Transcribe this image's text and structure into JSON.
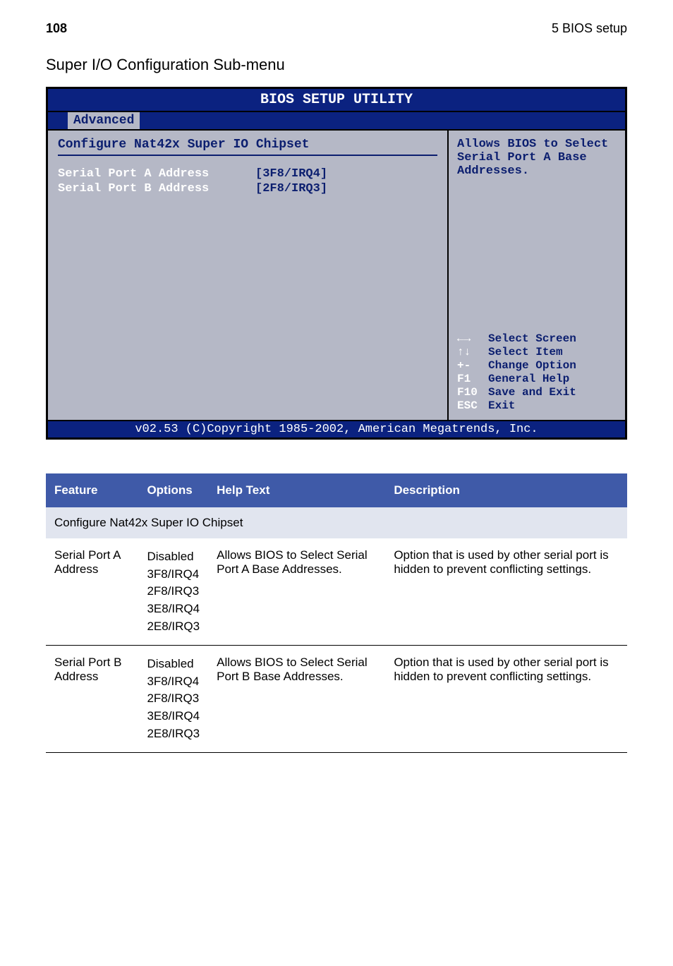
{
  "page": {
    "number": "108",
    "chapter": "5 BIOS setup"
  },
  "section_title": "Super I/O Configuration Sub-menu",
  "bios": {
    "title": "BIOS SETUP UTILITY",
    "tab": "Advanced",
    "left_heading": "Configure Nat42x Super IO Chipset",
    "rows": [
      {
        "label": "Serial Port A Address",
        "value": "[3F8/IRQ4]"
      },
      {
        "label": "Serial Port B Address",
        "value": "[2F8/IRQ3]"
      }
    ],
    "help_top": "Allows BIOS to Select Serial Port A Base Addresses.",
    "keys": [
      {
        "k": "←→",
        "t": "Select Screen"
      },
      {
        "k": "↑↓",
        "t": "Select Item"
      },
      {
        "k": "+-",
        "t": "Change Option"
      },
      {
        "k": "F1",
        "t": "General Help"
      },
      {
        "k": "F10",
        "t": "Save and Exit"
      },
      {
        "k": "ESC",
        "t": "Exit"
      }
    ],
    "footer": "v02.53 (C)Copyright 1985-2002, American Megatrends, Inc."
  },
  "table": {
    "headers": {
      "feature": "Feature",
      "options": "Options",
      "help": "Help Text",
      "desc": "Description"
    },
    "subheading": "Configure Nat42x Super IO Chipset",
    "rows": [
      {
        "feature": "Serial Port A Address",
        "options": [
          "Disabled",
          "3F8/IRQ4",
          "2F8/IRQ3",
          "3E8/IRQ4",
          "2E8/IRQ3"
        ],
        "help": "Allows BIOS to Select Serial Port A Base Addresses.",
        "desc": "Option that is used by other serial port is hidden to prevent conflicting settings."
      },
      {
        "feature": "Serial Port B Address",
        "options": [
          "Disabled",
          "3F8/IRQ4",
          "2F8/IRQ3",
          "3E8/IRQ4",
          "2E8/IRQ3"
        ],
        "help": "Allows BIOS to Select Serial Port B Base Addresses.",
        "desc": "Option that is used by other serial port is hidden to prevent conflicting settings."
      }
    ]
  }
}
